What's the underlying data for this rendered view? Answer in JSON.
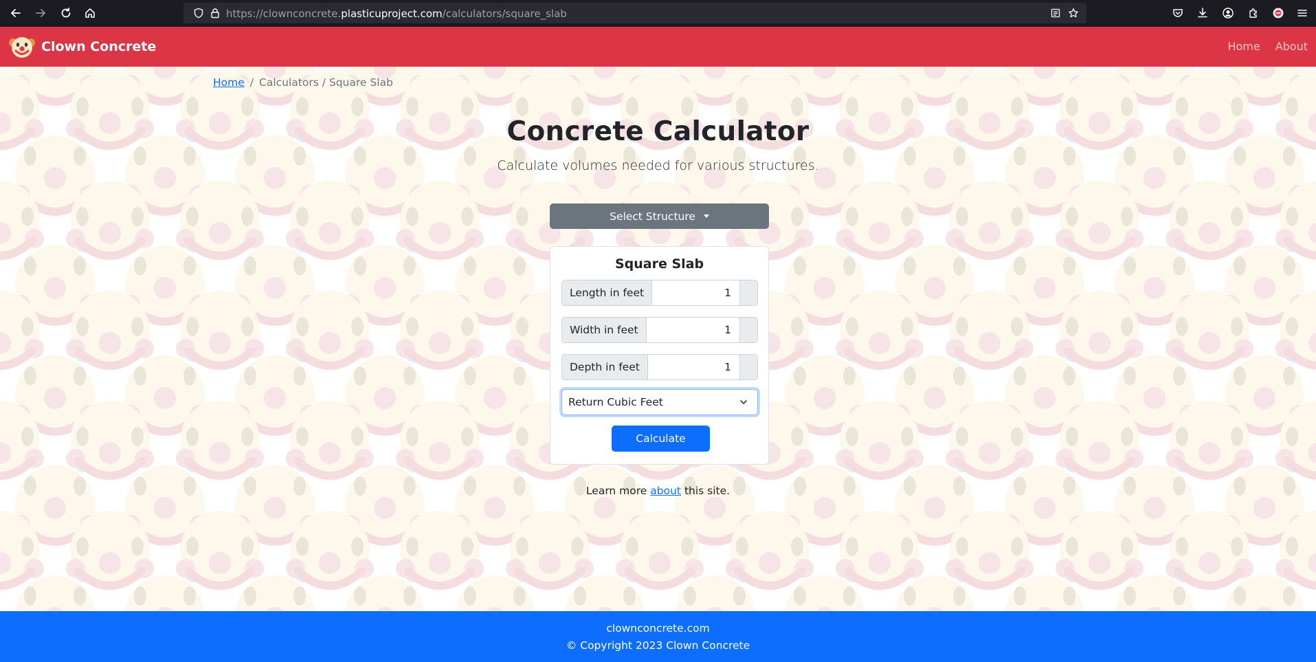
{
  "browser": {
    "url_prefix": "https://clownconcrete.",
    "url_host": "plasticuproject.com",
    "url_path": "/calculators/square_slab"
  },
  "navbar": {
    "brand": "Clown Concrete",
    "links": [
      "Home",
      "About"
    ],
    "color": "#dc3545"
  },
  "breadcrumb": {
    "home": "Home",
    "separator": "/",
    "trail": "Calculators / Square Slab"
  },
  "page": {
    "title": "Concrete Calculator",
    "subtitle": "Calculate volumes needed for various structures.",
    "select_structure": "Select Structure"
  },
  "calculator": {
    "title": "Square Slab",
    "fields": [
      {
        "label": "Length in feet",
        "value": "1"
      },
      {
        "label": "Width in feet",
        "value": "1"
      },
      {
        "label": "Depth in feet",
        "value": "1"
      }
    ],
    "unit_selected": "Return Cubic Feet",
    "calculate_label": "Calculate"
  },
  "learn_more": {
    "before": "Learn more",
    "link": "about",
    "after": "this site."
  },
  "footer": {
    "site": "clownconcrete.com",
    "copyright": "© Copyright 2023 Clown Concrete",
    "color": "#0d6efd"
  },
  "icons": [
    "back-icon",
    "forward-icon",
    "reload-icon",
    "home-icon",
    "shield-icon",
    "lock-icon",
    "reader-view-icon",
    "bookmark-star-icon",
    "pocket-icon",
    "download-icon",
    "account-icon",
    "extensions-icon",
    "profile-icon",
    "menu-icon",
    "clown-logo-icon",
    "chevron-down-icon"
  ]
}
